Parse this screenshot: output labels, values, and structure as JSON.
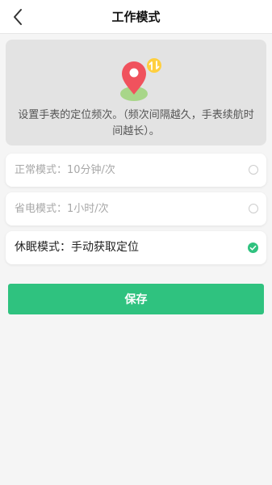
{
  "header": {
    "title": "工作模式",
    "back_icon": "chevron-left-icon"
  },
  "info": {
    "icon": "location-pin-swap-icon",
    "description": "设置手表的定位频次。（频次间隔越久，手表续航时间越长）。"
  },
  "modes": [
    {
      "label": "正常模式：10分钟/次",
      "selected": false
    },
    {
      "label": "省电模式：1小时/次",
      "selected": false
    },
    {
      "label": "休眠模式：手动获取定位",
      "selected": true
    }
  ],
  "save_label": "保存",
  "colors": {
    "accent": "#2fc27f",
    "pin": "#f0525d",
    "background": "#f5f5f5",
    "info_card": "#e3e3e3"
  }
}
